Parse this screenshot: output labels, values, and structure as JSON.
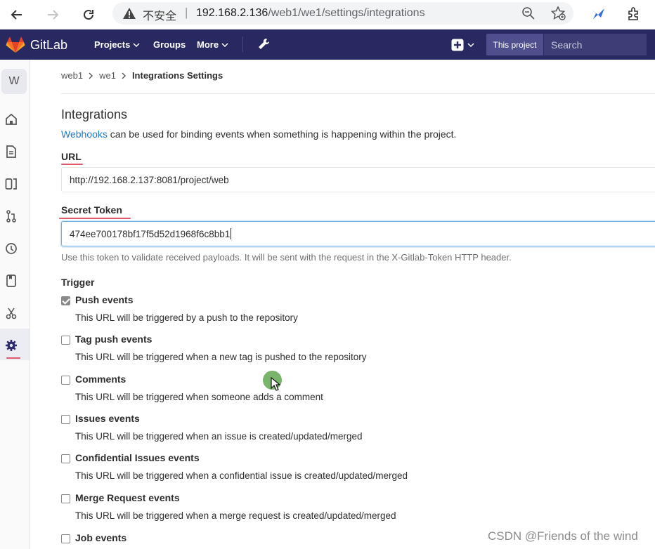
{
  "browser": {
    "insecure_label": "不安全",
    "separator": "|",
    "url_host": "192.168.2.136",
    "url_path": "/web1/we1/settings/integrations"
  },
  "header": {
    "app_name": "GitLab",
    "nav": [
      {
        "label": "Projects"
      },
      {
        "label": "Groups"
      },
      {
        "label": "More"
      }
    ],
    "scope_label": "This project",
    "search_placeholder": "Search",
    "colors": {
      "header_bg": "#292961",
      "accent": "#e05a6e",
      "link": "#1f78d1"
    }
  },
  "sidebar": {
    "avatar_letter": "W",
    "icons": [
      "home-icon",
      "document-icon",
      "issues-icon",
      "merge-request-icon",
      "pipeline-icon",
      "wiki-icon",
      "snippets-icon",
      "settings-icon"
    ],
    "active": "settings-icon"
  },
  "breadcrumb": {
    "items": [
      "web1",
      "we1"
    ],
    "current": "Integrations Settings"
  },
  "page": {
    "title": "Integrations",
    "description_link": "Webhooks",
    "description_rest": " can be used for binding events when something is happening within the project.",
    "url_label": "URL",
    "url_value": "http://192.168.2.137:8081/project/web",
    "token_label": "Secret Token",
    "token_value": "474ee700178bf17f5d52d1968f6c8bb1",
    "token_hint": "Use this token to validate received payloads. It will be sent with the request in the X-Gitlab-Token HTTP header.",
    "trigger_label": "Trigger"
  },
  "events": [
    {
      "title": "Push events",
      "desc": "This URL will be triggered by a push to the repository",
      "checked": true
    },
    {
      "title": "Tag push events",
      "desc": "This URL will be triggered when a new tag is pushed to the repository",
      "checked": false
    },
    {
      "title": "Comments",
      "desc": "This URL will be triggered when someone adds a comment",
      "checked": false
    },
    {
      "title": "Issues events",
      "desc": "This URL will be triggered when an issue is created/updated/merged",
      "checked": false
    },
    {
      "title": "Confidential Issues events",
      "desc": "This URL will be triggered when a confidential issue is created/updated/merged",
      "checked": false
    },
    {
      "title": "Merge Request events",
      "desc": "This URL will be triggered when a merge request is created/updated/merged",
      "checked": false
    },
    {
      "title": "Job events",
      "desc": "",
      "checked": false
    }
  ],
  "watermark": "CSDN @Friends of the wind"
}
